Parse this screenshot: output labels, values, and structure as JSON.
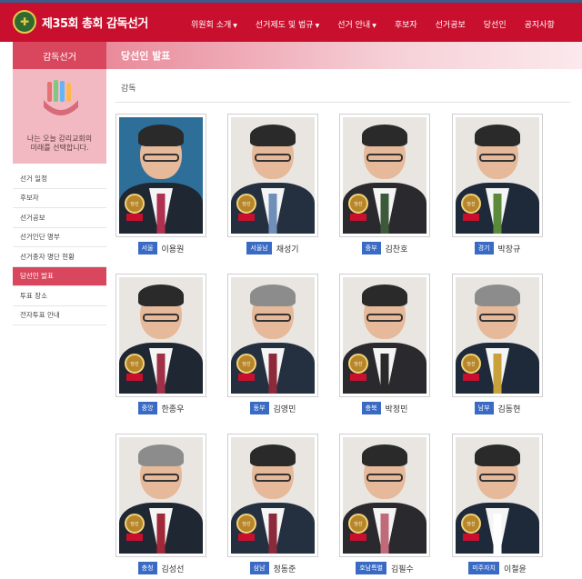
{
  "header": {
    "logo_emblem": "✚",
    "logo_text": "제35회 총회 감독선거",
    "nav": [
      {
        "label": "위원회 소개",
        "caret": "▼"
      },
      {
        "label": "선거제도 및 법규",
        "caret": "▼"
      },
      {
        "label": "선거 안내",
        "caret": "▼"
      },
      {
        "label": "후보자",
        "caret": ""
      },
      {
        "label": "선거공보",
        "caret": ""
      },
      {
        "label": "당선인",
        "caret": ""
      },
      {
        "label": "공지사항",
        "caret": ""
      }
    ]
  },
  "sidebar": {
    "title": "감독선거",
    "banner_line1": "나는 오늘 감리교회의",
    "banner_line2": "미래를 선택합니다.",
    "items": [
      {
        "label": "선거 일정",
        "active": false
      },
      {
        "label": "후보자",
        "active": false
      },
      {
        "label": "선거공보",
        "active": false
      },
      {
        "label": "선거인단 명부",
        "active": false
      },
      {
        "label": "선거종자 명단 현황",
        "active": false
      },
      {
        "label": "당선인 발표",
        "active": true
      },
      {
        "label": "투표 장소",
        "active": false
      },
      {
        "label": "전자투표 안내",
        "active": false
      }
    ]
  },
  "main": {
    "title": "당선인 발표",
    "breadcrumb": "감독",
    "medal_text": "당선",
    "winners": [
      {
        "region": "서울",
        "name": "이용원"
      },
      {
        "region": "서울남",
        "name": "채성기"
      },
      {
        "region": "중부",
        "name": "김찬호"
      },
      {
        "region": "경기",
        "name": "박장규"
      },
      {
        "region": "중앙",
        "name": "한종우"
      },
      {
        "region": "동부",
        "name": "김영민"
      },
      {
        "region": "충북",
        "name": "박정민"
      },
      {
        "region": "남부",
        "name": "김동현"
      },
      {
        "region": "충청",
        "name": "김성선"
      },
      {
        "region": "삼남",
        "name": "정동준"
      },
      {
        "region": "호남특별",
        "name": "김필수"
      },
      {
        "region": "미주자치",
        "name": "이철윤"
      }
    ]
  },
  "colors": {
    "primary": "#c8102e",
    "accent": "#d9475e",
    "region_badge": "#3a6bc4"
  }
}
